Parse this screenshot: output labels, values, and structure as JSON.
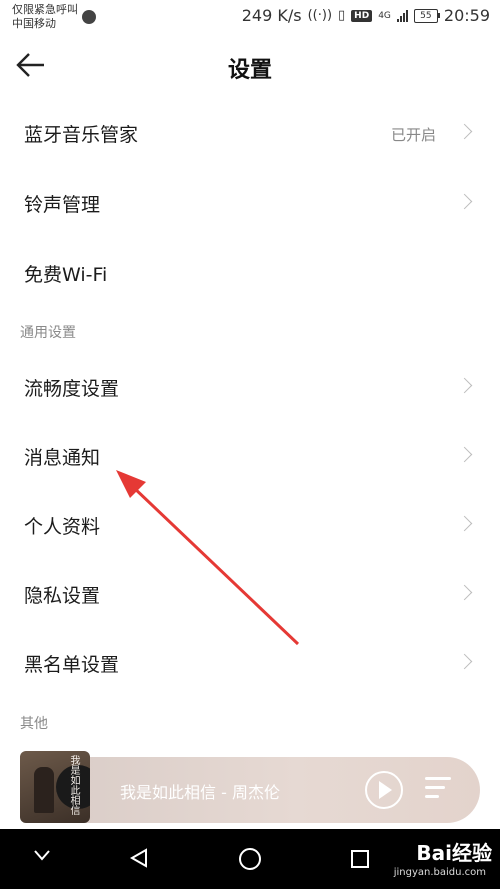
{
  "status_bar": {
    "carrier_line1": "仅限紧急呼叫",
    "carrier_line2": "中国移动",
    "net_speed": "249 K/s",
    "network_type": "4G",
    "battery": "55",
    "time": "20:59",
    "icons": [
      "globe-icon",
      "hotspot-icon",
      "vibrate-icon",
      "hd-icon",
      "signal-icon",
      "battery-icon"
    ]
  },
  "header": {
    "title": "设置",
    "back_icon": "arrow-left-icon"
  },
  "rows": [
    {
      "label": "蓝牙音乐管家",
      "value": "已开启",
      "chevron": true
    },
    {
      "label": "铃声管理",
      "value": "",
      "chevron": true
    },
    {
      "label": "免费Wi-Fi",
      "value": "",
      "chevron": false
    }
  ],
  "sections": {
    "general": "通用设置",
    "other": "其他"
  },
  "general_rows": [
    {
      "label": "流畅度设置",
      "chevron": true
    },
    {
      "label": "消息通知",
      "chevron": true
    },
    {
      "label": "个人资料",
      "chevron": true
    },
    {
      "label": "隐私设置",
      "chevron": true
    },
    {
      "label": "黑名单设置",
      "chevron": true
    }
  ],
  "player": {
    "song": "我是如此相信 - 周杰伦",
    "cover_text": "我是如此相信"
  },
  "watermark": {
    "brand": "Bai经验",
    "url": "jingyan.baidu.com"
  },
  "colors": {
    "annotation_arrow": "#e53935",
    "player_bg": "#e0d3cd"
  }
}
